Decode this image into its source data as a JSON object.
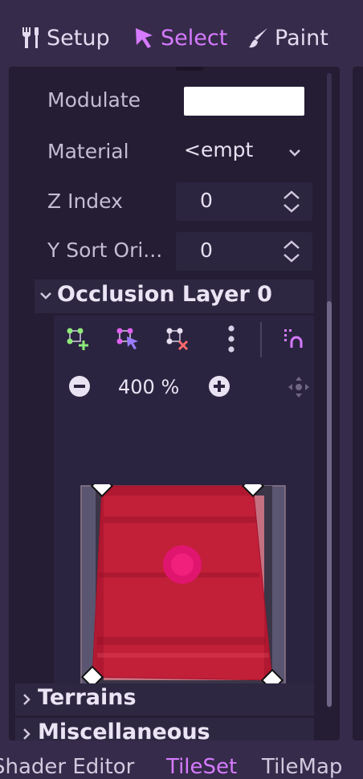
{
  "modes": [
    {
      "label": "Setup",
      "icon": "wrench-screwdriver-icon",
      "active": false
    },
    {
      "label": "Select",
      "icon": "cursor-arrow-icon",
      "active": true
    },
    {
      "label": "Paint",
      "icon": "paintbrush-icon",
      "active": false
    }
  ],
  "properties": {
    "modulate_label": "Modulate",
    "modulate_color": "#ffffff",
    "material_label": "Material",
    "material_value": "<empt",
    "z_index_label": "Z Index",
    "z_index_value": "0",
    "y_sort_label": "Y Sort Ori...",
    "y_sort_value": "0"
  },
  "occlusion_section": {
    "title": "Occlusion Layer 0"
  },
  "polygon_toolbar": {
    "tools": [
      "create-polygon-icon",
      "edit-points-icon",
      "delete-points-icon",
      "more-options-icon",
      "snap-icon"
    ]
  },
  "zoom": {
    "value": "400 %"
  },
  "groups": {
    "terrains": "Terrains",
    "miscellaneous": "Miscellaneous"
  },
  "bottom_tabs": [
    {
      "label": "Shader Editor",
      "active": false
    },
    {
      "label": "TileSet",
      "active": true
    },
    {
      "label": "TileMap",
      "active": false
    }
  ],
  "colors": {
    "accent": "#d67aff",
    "panel_bg": "#241d33",
    "occluder_fill": "#c0142e"
  }
}
